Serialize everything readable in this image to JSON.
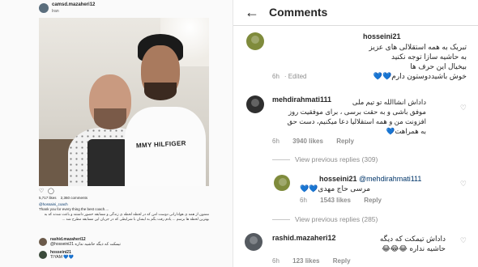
{
  "post": {
    "username": "camsd.mazaheri12",
    "location": "Iran",
    "shirt_text": "MMY HILFIGER",
    "likes": "5,717 likes",
    "comments_count": "2,360 comments",
    "caption_user": "@hossaini_coach",
    "caption_en": "Thank you for every thing the best coach....",
    "caption_fa": "ممنون از همه ی هوادارانی دوست امن که در لحظه لحظه ی زندگی و مسابقه حضور داشتند و باعث شدند که به بهترین لحظه ها برسم ... یادم رفت بگم به ایشان با شرایطی که در جریان این مسابقه مطرح شد ... ",
    "mini_comments": [
      {
        "user": "rashid.mazaheri12",
        "text": "@hosseini21 تیمکت که دیگه حاشیه نداره"
      },
      {
        "user": "hosseini21",
        "text": "TIYAM 💙💙"
      }
    ]
  },
  "screen": {
    "title": "Comments",
    "back_icon": "back-arrow-icon"
  },
  "comments": [
    {
      "user": "hosseini21",
      "lines": [
        "تبریک به همه استقلالی های عزیز",
        "به حاشیه سازا توجه نکنید",
        "بیخیال این حرف ها",
        "خوش باشیددوستون دارم💙💙"
      ],
      "time": "6h",
      "likes": "",
      "edited": "· Edited",
      "reply": ""
    },
    {
      "user": "mehdirahmati111",
      "lines": [
        "داداش انشاالله تو تیم ملی",
        "موفق باشی و به حقت برسی ، برای موفقیت روز",
        "افزونت من و همه استقلالیا دعا میکنیم، دست حق",
        "به همراهت💙"
      ],
      "time": "6h",
      "likes": "3940 likes",
      "edited": "",
      "reply": "Reply"
    },
    {
      "user": "hosseini21",
      "mention": "@mehdirahmati111",
      "lines": [
        "مرسی حاج مهدی💙💙"
      ],
      "time": "6h",
      "likes": "1543 likes",
      "edited": "",
      "reply": "Reply"
    },
    {
      "user": "rashid.mazaheri12",
      "lines": [
        "داداش تیمکت که دیگه",
        "حاشیه نداره 😂😂😂"
      ],
      "time": "6h",
      "likes": "123 likes",
      "edited": "",
      "reply": "Reply"
    }
  ],
  "view_previous_1": "View previous replies (309)",
  "view_previous_2": "View previous replies (285)",
  "colors": {
    "accent_heart": "#5ac8e0",
    "muted": "#8e8e8e",
    "text": "#262626"
  }
}
